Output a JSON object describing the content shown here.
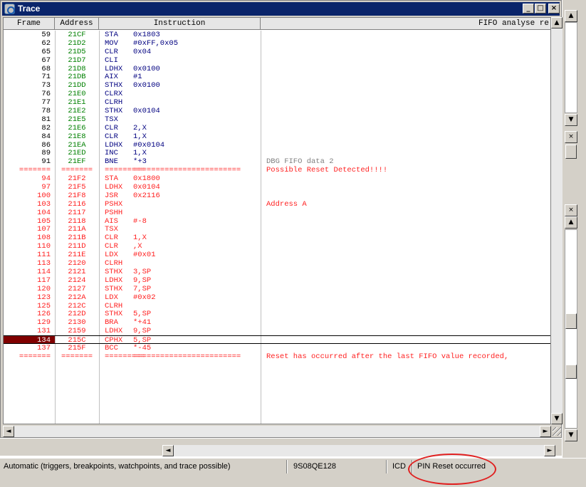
{
  "window": {
    "title": "Trace",
    "caption_buttons": {
      "minimize": "_",
      "maximize": "□",
      "close": "×"
    }
  },
  "columns": {
    "frame": "Frame",
    "address": "Address",
    "instruction": "Instruction",
    "fifo": "FIFO analyse re"
  },
  "rows": [
    {
      "frame": "59",
      "addr": "21CF",
      "mn": "STA",
      "op": "0x1803",
      "fifo": "",
      "style": "black"
    },
    {
      "frame": "62",
      "addr": "21D2",
      "mn": "MOV",
      "op": "#0xFF,0x05",
      "fifo": "",
      "style": "black"
    },
    {
      "frame": "65",
      "addr": "21D5",
      "mn": "CLR",
      "op": "0x04",
      "fifo": "",
      "style": "black"
    },
    {
      "frame": "67",
      "addr": "21D7",
      "mn": "CLI",
      "op": "",
      "fifo": "",
      "style": "black"
    },
    {
      "frame": "68",
      "addr": "21D8",
      "mn": "LDHX",
      "op": "0x0100",
      "fifo": "",
      "style": "black"
    },
    {
      "frame": "71",
      "addr": "21DB",
      "mn": "AIX",
      "op": "#1",
      "fifo": "",
      "style": "black"
    },
    {
      "frame": "73",
      "addr": "21DD",
      "mn": "STHX",
      "op": "0x0100",
      "fifo": "",
      "style": "black"
    },
    {
      "frame": "76",
      "addr": "21E0",
      "mn": "CLRX",
      "op": "",
      "fifo": "",
      "style": "black"
    },
    {
      "frame": "77",
      "addr": "21E1",
      "mn": "CLRH",
      "op": "",
      "fifo": "",
      "style": "black"
    },
    {
      "frame": "78",
      "addr": "21E2",
      "mn": "STHX",
      "op": "0x0104",
      "fifo": "",
      "style": "black"
    },
    {
      "frame": "81",
      "addr": "21E5",
      "mn": "TSX",
      "op": "",
      "fifo": "",
      "style": "black"
    },
    {
      "frame": "82",
      "addr": "21E6",
      "mn": "CLR",
      "op": "2,X",
      "fifo": "",
      "style": "black"
    },
    {
      "frame": "84",
      "addr": "21E8",
      "mn": "CLR",
      "op": "1,X",
      "fifo": "",
      "style": "black"
    },
    {
      "frame": "86",
      "addr": "21EA",
      "mn": "LDHX",
      "op": "#0x0104",
      "fifo": "",
      "style": "black"
    },
    {
      "frame": "89",
      "addr": "21ED",
      "mn": "INC",
      "op": "1,X",
      "fifo": "",
      "style": "black"
    },
    {
      "frame": "91",
      "addr": "21EF",
      "mn": "BNE",
      "op": "*+3",
      "fifo": "DBG FIFO data 2",
      "style": "black",
      "fifo_style": "gray"
    },
    {
      "frame": "=======",
      "addr": "=======",
      "mn": "=========",
      "op": "========================",
      "fifo": "Possible Reset Detected!!!!",
      "style": "red",
      "fifo_style": "red"
    },
    {
      "frame": "94",
      "addr": "21F2",
      "mn": "STA",
      "op": "0x1800",
      "fifo": "",
      "style": "red"
    },
    {
      "frame": "97",
      "addr": "21F5",
      "mn": "LDHX",
      "op": "0x0104",
      "fifo": "",
      "style": "red"
    },
    {
      "frame": "100",
      "addr": "21F8",
      "mn": "JSR",
      "op": "0x2116",
      "fifo": "",
      "style": "red"
    },
    {
      "frame": "103",
      "addr": "2116",
      "mn": "PSHX",
      "op": "",
      "fifo": "Address A",
      "style": "red",
      "fifo_style": "red"
    },
    {
      "frame": "104",
      "addr": "2117",
      "mn": "PSHH",
      "op": "",
      "fifo": "",
      "style": "red"
    },
    {
      "frame": "105",
      "addr": "2118",
      "mn": "AIS",
      "op": "#-8",
      "fifo": "",
      "style": "red"
    },
    {
      "frame": "107",
      "addr": "211A",
      "mn": "TSX",
      "op": "",
      "fifo": "",
      "style": "red"
    },
    {
      "frame": "108",
      "addr": "211B",
      "mn": "CLR",
      "op": "1,X",
      "fifo": "",
      "style": "red"
    },
    {
      "frame": "110",
      "addr": "211D",
      "mn": "CLR",
      "op": ",X",
      "fifo": "",
      "style": "red"
    },
    {
      "frame": "111",
      "addr": "211E",
      "mn": "LDX",
      "op": "#0x01",
      "fifo": "",
      "style": "red"
    },
    {
      "frame": "113",
      "addr": "2120",
      "mn": "CLRH",
      "op": "",
      "fifo": "",
      "style": "red"
    },
    {
      "frame": "114",
      "addr": "2121",
      "mn": "STHX",
      "op": "3,SP",
      "fifo": "",
      "style": "red"
    },
    {
      "frame": "117",
      "addr": "2124",
      "mn": "LDHX",
      "op": "9,SP",
      "fifo": "",
      "style": "red"
    },
    {
      "frame": "120",
      "addr": "2127",
      "mn": "STHX",
      "op": "7,SP",
      "fifo": "",
      "style": "red"
    },
    {
      "frame": "123",
      "addr": "212A",
      "mn": "LDX",
      "op": "#0x02",
      "fifo": "",
      "style": "red"
    },
    {
      "frame": "125",
      "addr": "212C",
      "mn": "CLRH",
      "op": "",
      "fifo": "",
      "style": "red"
    },
    {
      "frame": "126",
      "addr": "212D",
      "mn": "STHX",
      "op": "5,SP",
      "fifo": "",
      "style": "red"
    },
    {
      "frame": "129",
      "addr": "2130",
      "mn": "BRA",
      "op": "*+41",
      "fifo": "",
      "style": "red"
    },
    {
      "frame": "131",
      "addr": "2159",
      "mn": "LDHX",
      "op": "9,SP",
      "fifo": "",
      "style": "red"
    },
    {
      "frame": "134",
      "addr": "215C",
      "mn": "CPHX",
      "op": "5,SP",
      "fifo": "",
      "style": "red",
      "selected": true
    },
    {
      "frame": "137",
      "addr": "215F",
      "mn": "BCC",
      "op": "*-45",
      "fifo": "",
      "style": "red"
    },
    {
      "frame": "=======",
      "addr": "=======",
      "mn": "=========",
      "op": "========================",
      "fifo": "Reset has occurred after the last FIFO value recorded,",
      "style": "red",
      "fifo_style": "red"
    }
  ],
  "status": {
    "mode": "Automatic (triggers, breakpoints, watchpoints, and trace possible)",
    "device": "9S08QE128",
    "connection": "ICD",
    "message": "PIN Reset occurred"
  },
  "colors": {
    "title_bar": "#0a246a",
    "pre_reset_text": "#000080",
    "address_text": "#008000",
    "post_reset_text": "#ff2020",
    "selected_frame_bg": "#800000",
    "annotation_ellipse": "#e02020"
  },
  "icons": {
    "window_icon": "trace-window-icon",
    "scroll_up": "▲",
    "scroll_down": "▼",
    "scroll_left": "◄",
    "scroll_right": "►",
    "close_mark": "×"
  }
}
